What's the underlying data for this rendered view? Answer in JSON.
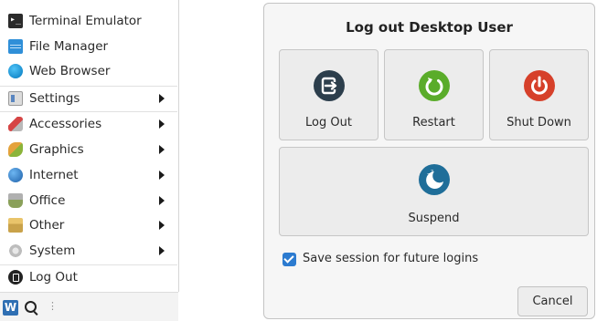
{
  "menu": {
    "favorites": [
      {
        "label": "Terminal Emulator",
        "icon": "terminal-icon"
      },
      {
        "label": "File Manager",
        "icon": "file-manager-icon"
      },
      {
        "label": "Web Browser",
        "icon": "web-browser-icon"
      }
    ],
    "categories": [
      {
        "label": "Settings",
        "icon": "settings-icon"
      },
      {
        "label": "Accessories",
        "icon": "accessories-icon"
      },
      {
        "label": "Graphics",
        "icon": "graphics-icon"
      },
      {
        "label": "Internet",
        "icon": "internet-icon"
      },
      {
        "label": "Office",
        "icon": "office-icon"
      },
      {
        "label": "Other",
        "icon": "other-icon"
      },
      {
        "label": "System",
        "icon": "system-icon"
      }
    ],
    "logout": {
      "label": "Log Out",
      "icon": "logout-icon"
    }
  },
  "taskbar": {
    "whisker_glyph": "W",
    "grip_glyph": "⋮"
  },
  "dialog": {
    "title": "Log out Desktop User",
    "actions": [
      {
        "label": "Log Out",
        "icon": "log-out-icon",
        "color": "#2c3e4c"
      },
      {
        "label": "Restart",
        "icon": "restart-icon",
        "color": "#5aac2a"
      },
      {
        "label": "Shut Down",
        "icon": "shut-down-icon",
        "color": "#d6402a"
      },
      {
        "label": "Suspend",
        "icon": "suspend-icon",
        "color": "#1f6e99"
      }
    ],
    "save_session": {
      "label": "Save session for future logins",
      "checked": true
    },
    "cancel_label": "Cancel"
  }
}
